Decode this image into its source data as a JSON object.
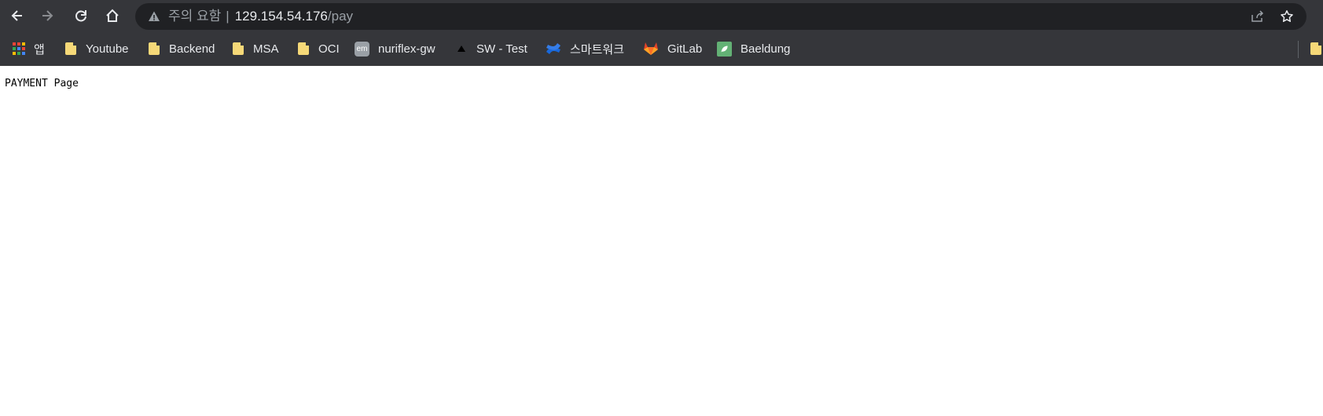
{
  "browser": {
    "omnibox": {
      "security_label": "주의 요함",
      "separator": "|",
      "host": "129.154.54.176",
      "path": "/pay"
    },
    "bookmarks": [
      {
        "label": "앱",
        "icon": "apps-grid-icon"
      },
      {
        "label": "Youtube",
        "icon": "folder-icon"
      },
      {
        "label": "Backend",
        "icon": "folder-icon"
      },
      {
        "label": "MSA",
        "icon": "folder-icon"
      },
      {
        "label": "OCI",
        "icon": "folder-icon"
      },
      {
        "label": "nuriflex-gw",
        "icon": "em-favicon-icon",
        "icon_text": "em"
      },
      {
        "label": "SW - Test",
        "icon": "sailboat-favicon-icon"
      },
      {
        "label": "스마트워크",
        "icon": "confluence-favicon-icon"
      },
      {
        "label": "GitLab",
        "icon": "gitlab-favicon-icon"
      },
      {
        "label": "Baeldung",
        "icon": "baeldung-favicon-icon"
      }
    ]
  },
  "page": {
    "text": "PAYMENT Page"
  },
  "colors": {
    "toolbar_bg": "#35363a",
    "omnibox_bg": "#202124",
    "text_light": "#e8eaed",
    "text_muted": "#9aa0a6",
    "folder": "#f6d978"
  }
}
